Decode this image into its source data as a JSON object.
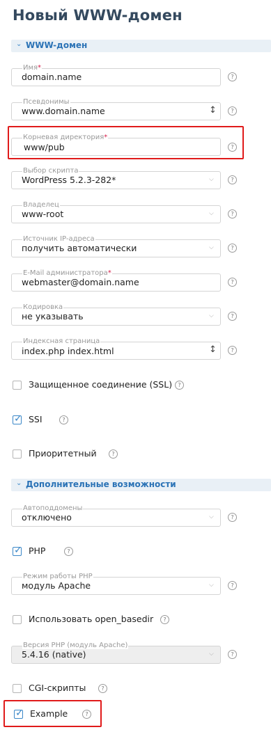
{
  "page": {
    "title": "Новый WWW-домен"
  },
  "sections": {
    "main": "WWW-домен",
    "extra": "Дополнительные возможности"
  },
  "fields": {
    "name": {
      "label": "Имя",
      "value": "domain.name"
    },
    "aliases": {
      "label": "Псевдонимы",
      "value": "www.domain.name"
    },
    "root": {
      "label": "Корневая директория",
      "value": "www/pub"
    },
    "script": {
      "label": "Выбор скрипта",
      "value": "WordPress 5.2.3-282*"
    },
    "owner": {
      "label": "Владелец",
      "value": "www-root"
    },
    "ip": {
      "label": "Источник IP-адреса",
      "value": "получить автоматически"
    },
    "email": {
      "label": "E-Mail администратора",
      "value": "webmaster@domain.name"
    },
    "charset": {
      "label": "Кодировка",
      "value": "не указывать"
    },
    "index": {
      "label": "Индексная страница",
      "value": "index.php index.html"
    },
    "autosub": {
      "label": "Автоподдомены",
      "value": "отключено"
    },
    "phpmode": {
      "label": "Режим работы PHP",
      "value": "модуль Apache"
    },
    "phpver": {
      "label": "Версия PHP (модуль Apache)",
      "value": "5.4.16 (native)"
    }
  },
  "checkboxes": {
    "ssl": {
      "label": "Защищенное соединение (SSL)",
      "checked": false
    },
    "ssi": {
      "label": "SSI",
      "checked": true
    },
    "priority": {
      "label": "Приоритетный",
      "checked": false
    },
    "php": {
      "label": "PHP",
      "checked": true
    },
    "openbasedir": {
      "label": "Использовать open_basedir",
      "checked": false
    },
    "cgi": {
      "label": "CGI-скрипты",
      "checked": false
    },
    "example": {
      "label": "Example",
      "checked": true
    }
  },
  "symbols": {
    "required": "*",
    "help": "?",
    "chevron": "⌄",
    "select_arrow": "⌵",
    "resize": "↕",
    "check": "✓"
  },
  "colors": {
    "accent": "#3a87c8",
    "highlight": "#e01a1a",
    "required": "#d6204b",
    "title": "#34495e"
  }
}
